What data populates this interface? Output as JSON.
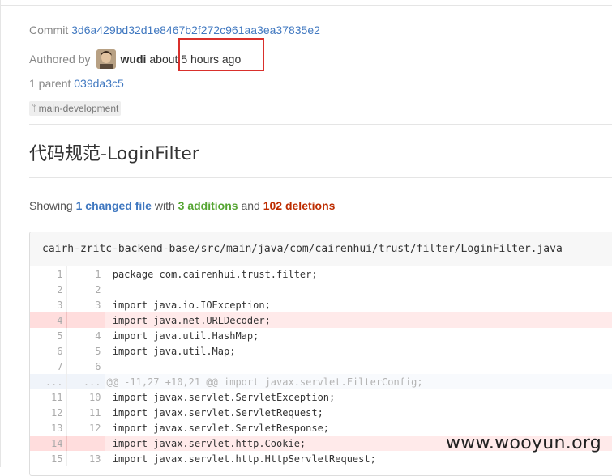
{
  "commit": {
    "label": "Commit",
    "sha": "3d6a429bd32d1e8467b2f272c961aa3ea37835e2",
    "authored_label": "Authored by",
    "author": "wudi",
    "time": "about 5 hours ago",
    "parent_label": "1 parent",
    "parent_sha": "039da3c5",
    "branch": "main-development",
    "title": "代码规范-LoginFilter"
  },
  "summary": {
    "showing": "Showing",
    "files_count": "1",
    "files_label": "changed file",
    "with": "with",
    "additions_count": "3",
    "additions_label": "additions",
    "and": "and",
    "deletions_count": "102",
    "deletions_label": "deletions"
  },
  "file": {
    "path": "cairh-zritc-backend-base/src/main/java/com/cairenhui/trust/filter/LoginFilter.java",
    "lines": [
      {
        "old": "1",
        "new": "1",
        "type": "ctx",
        "text": " package com.cairenhui.trust.filter;"
      },
      {
        "old": "2",
        "new": "2",
        "type": "ctx",
        "text": ""
      },
      {
        "old": "3",
        "new": "3",
        "type": "ctx",
        "text": " import java.io.IOException;"
      },
      {
        "old": "4",
        "new": "",
        "type": "del",
        "text": "-import java.net.URLDecoder;"
      },
      {
        "old": "5",
        "new": "4",
        "type": "ctx",
        "text": " import java.util.HashMap;"
      },
      {
        "old": "6",
        "new": "5",
        "type": "ctx",
        "text": " import java.util.Map;"
      },
      {
        "old": "7",
        "new": "6",
        "type": "ctx",
        "text": ""
      },
      {
        "old": "...",
        "new": "...",
        "type": "hunk",
        "text": "@@ -11,27 +10,21 @@ import javax.servlet.FilterConfig;"
      },
      {
        "old": "11",
        "new": "10",
        "type": "ctx",
        "text": " import javax.servlet.ServletException;"
      },
      {
        "old": "12",
        "new": "11",
        "type": "ctx",
        "text": " import javax.servlet.ServletRequest;"
      },
      {
        "old": "13",
        "new": "12",
        "type": "ctx",
        "text": " import javax.servlet.ServletResponse;"
      },
      {
        "old": "14",
        "new": "",
        "type": "del",
        "text": "-import javax.servlet.http.Cookie;"
      },
      {
        "old": "15",
        "new": "13",
        "type": "ctx",
        "text": " import javax.servlet.http.HttpServletRequest;"
      }
    ]
  },
  "watermark": "www.wooyun.org",
  "colors": {
    "link": "#4078c0",
    "additions": "#55a532",
    "deletions": "#bd2c00",
    "highlight": "#d9302c",
    "deleted_row": "#ffeaea"
  }
}
